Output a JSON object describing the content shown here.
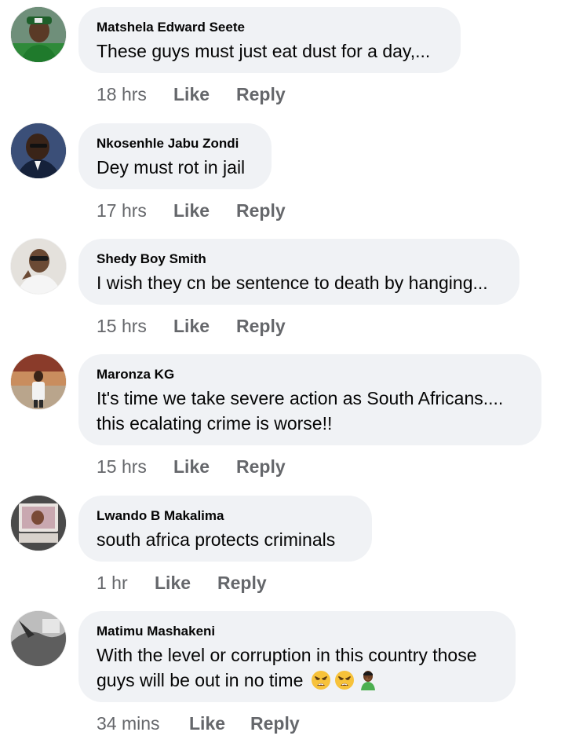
{
  "comments": [
    {
      "author": "Matshela Edward Seete",
      "lines": [
        "These guys must just eat dust for a day,..."
      ],
      "time": "18 hrs",
      "like": "Like",
      "reply": "Reply"
    },
    {
      "author": "Nkosenhle Jabu Zondi",
      "lines": [
        "Dey must rot in jail"
      ],
      "time": "17 hrs",
      "like": "Like",
      "reply": "Reply"
    },
    {
      "author": "Shedy Boy Smith",
      "lines": [
        "I wish they cn be sentence to death by hanging..."
      ],
      "time": "15 hrs",
      "like": "Like",
      "reply": "Reply"
    },
    {
      "author": "Maronza KG",
      "lines": [
        "It's time we take severe action as South Africans....",
        "this ecalating crime is worse!!"
      ],
      "time": "15 hrs",
      "like": "Like",
      "reply": "Reply"
    },
    {
      "author": "Lwando B Makalima",
      "lines": [
        "south africa protects criminals"
      ],
      "time": "1 hr",
      "like": "Like",
      "reply": "Reply"
    },
    {
      "author": "Matimu Mashakeni",
      "lines": [
        "With the level or corruption in this country those",
        "guys will be out in no time"
      ],
      "emojis": [
        "weary-face-emoji",
        "weary-face-emoji",
        "man-facepalming-emoji"
      ],
      "time": "34 mins",
      "like": "Like",
      "reply": "Reply"
    }
  ]
}
